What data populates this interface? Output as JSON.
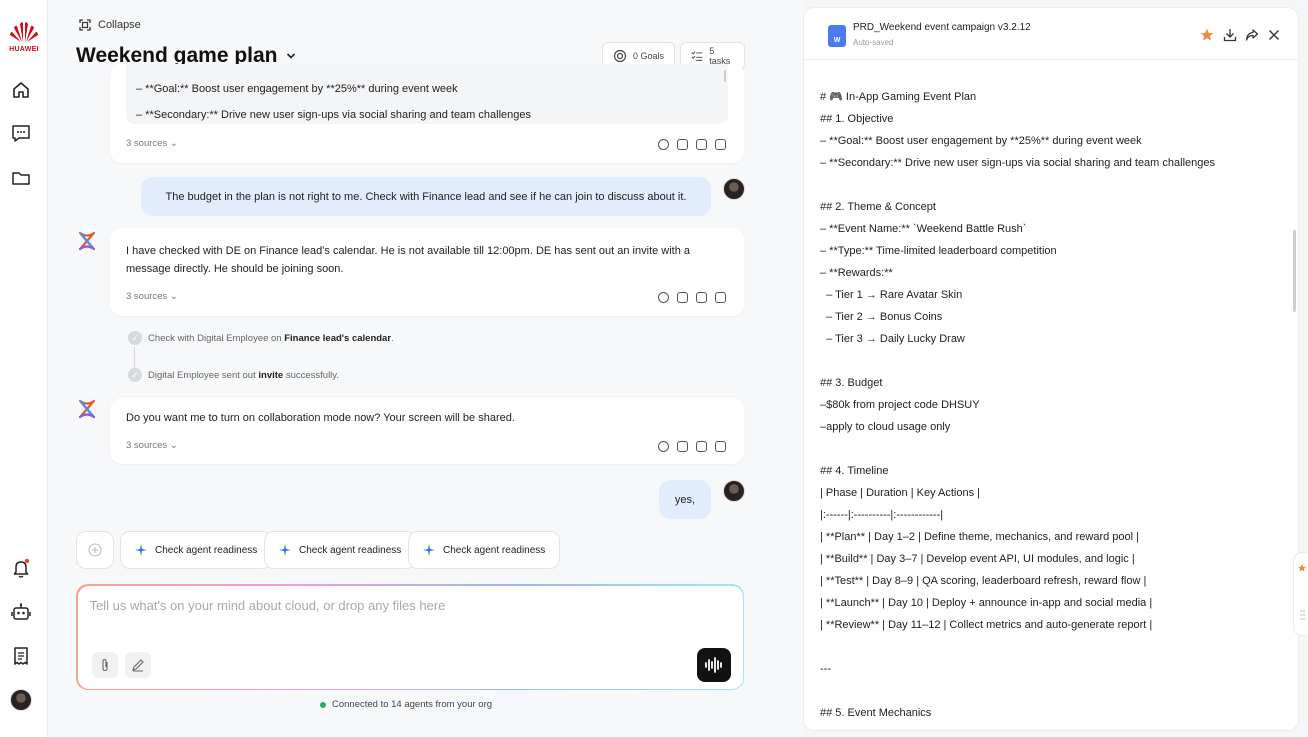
{
  "brand": {
    "name": "HUAWEI"
  },
  "header": {
    "collapse_label": "Collapse",
    "title": "Weekend game plan",
    "goals_label": "0 Goals",
    "tasks_label": "5 tasks"
  },
  "conversation": {
    "msg1_line1": "– **Goal:** Boost user engagement by **25%** during event week",
    "msg1_line2": "– **Secondary:** Drive new user sign-ups via social sharing and team challenges",
    "sources_label": "3 sources",
    "user1": "The budget in the plan is not right to me. Check with Finance lead and see if he can join to discuss about it.",
    "msg2": "I have checked with DE on Finance lead's calendar. He is not available till 12:00pm. DE has sent out an invite with a message directly. He should be joining soon.",
    "step1_prefix": "Check with Digital Employee on ",
    "step1_bold": "Finance lead's calendar",
    "step1_suffix": ".",
    "step2_prefix": "Digital Employee sent out ",
    "step2_bold": "invite",
    "step2_suffix": " successfully.",
    "msg3": "Do you want me to turn on collaboration mode now? Your screen will be shared.",
    "user2": "yes,"
  },
  "suggestions": [
    "Check agent readiness",
    "Check agent readiness",
    "Check agent readiness"
  ],
  "composer": {
    "placeholder": "Tell us what's on your mind about cloud, or drop any files here",
    "connected_label": "Connected to 14 agents from your org"
  },
  "document": {
    "title": "PRD_Weekend event campaign v3.2.12",
    "status": "Auto-saved",
    "icon_letter": "W",
    "lines": [
      "# 🎮 In-App Gaming Event Plan",
      "## 1. Objective",
      "– **Goal:** Boost user engagement by **25%** during event week",
      "– **Secondary:** Drive new user sign-ups via social sharing and team challenges",
      "",
      "## 2. Theme & Concept",
      "– **Event Name:** `Weekend Battle Rush`",
      "– **Type:** Time-limited leaderboard competition",
      "– **Rewards:**",
      "  – Tier 1 → Rare Avatar Skin",
      "  – Tier 2 → Bonus Coins",
      "  – Tier 3 → Daily Lucky Draw",
      "",
      "## 3. Budget",
      "–$80k from project code DHSUY",
      "–apply to cloud usage only",
      "",
      "## 4. Timeline",
      "| Phase | Duration | Key Actions |",
      "|:------|:----------|:------------|",
      "| **Plan** | Day 1–2 | Define theme, mechanics, and reward pool |",
      "| **Build** | Day 3–7 | Develop event API, UI modules, and logic |",
      "| **Test** | Day 8–9 | QA scoring, leaderboard refresh, reward flow |",
      "| **Launch** | Day 10 | Deploy + announce in-app and social media |",
      "| **Review** | Day 11–12 | Collect metrics and auto-generate report |",
      "",
      "---",
      "",
      "## 5. Event Mechanics"
    ]
  },
  "colors": {
    "accent": "#d40a1a",
    "bubble": "#e1ecfc",
    "star": "#f08a3e",
    "doc_icon": "#4a7af0"
  }
}
